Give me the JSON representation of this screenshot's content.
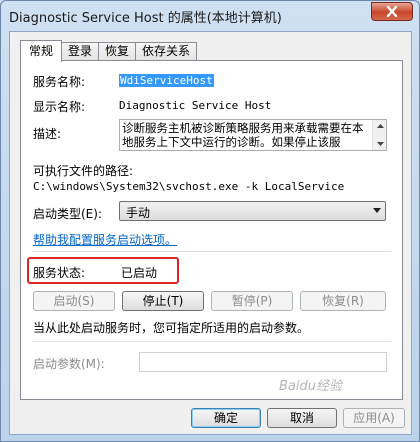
{
  "window": {
    "title": "Diagnostic Service Host 的属性(本地计算机)"
  },
  "tabs": [
    {
      "label": "常规",
      "active": true
    },
    {
      "label": "登录",
      "active": false
    },
    {
      "label": "恢复",
      "active": false
    },
    {
      "label": "依存关系",
      "active": false
    }
  ],
  "general": {
    "service_name_label": "服务名称:",
    "service_name_value": "WdiServiceHost",
    "display_name_label": "显示名称:",
    "display_name_value": "Diagnostic Service Host",
    "description_label": "描述:",
    "description_value": "诊断服务主机被诊断策略服务用来承载需要在本地服务上下文中运行的诊断。如果停止该服",
    "exe_path_label": "可执行文件的路径:",
    "exe_path_value": "C:\\windows\\System32\\svchost.exe -k LocalService",
    "startup_type_label": "启动类型(E):",
    "startup_type_value": "手动",
    "help_link": "帮助我配置服务启动选项。",
    "status_label": "服务状态:",
    "status_value": "已启动",
    "buttons": {
      "start": "启动(S)",
      "stop": "停止(T)",
      "pause": "暂停(P)",
      "resume": "恢复(R)"
    },
    "hint": "当从此处启动服务时，您可指定所适用的启动参数。",
    "start_params_label": "启动参数(M):",
    "start_params_value": ""
  },
  "footer": {
    "ok": "确定",
    "cancel": "取消",
    "apply": "应用(A)"
  },
  "watermark": "Baidu经验",
  "colors": {
    "highlight_box": "#e02424",
    "link": "#0066cc",
    "selection": "#3399ff"
  }
}
